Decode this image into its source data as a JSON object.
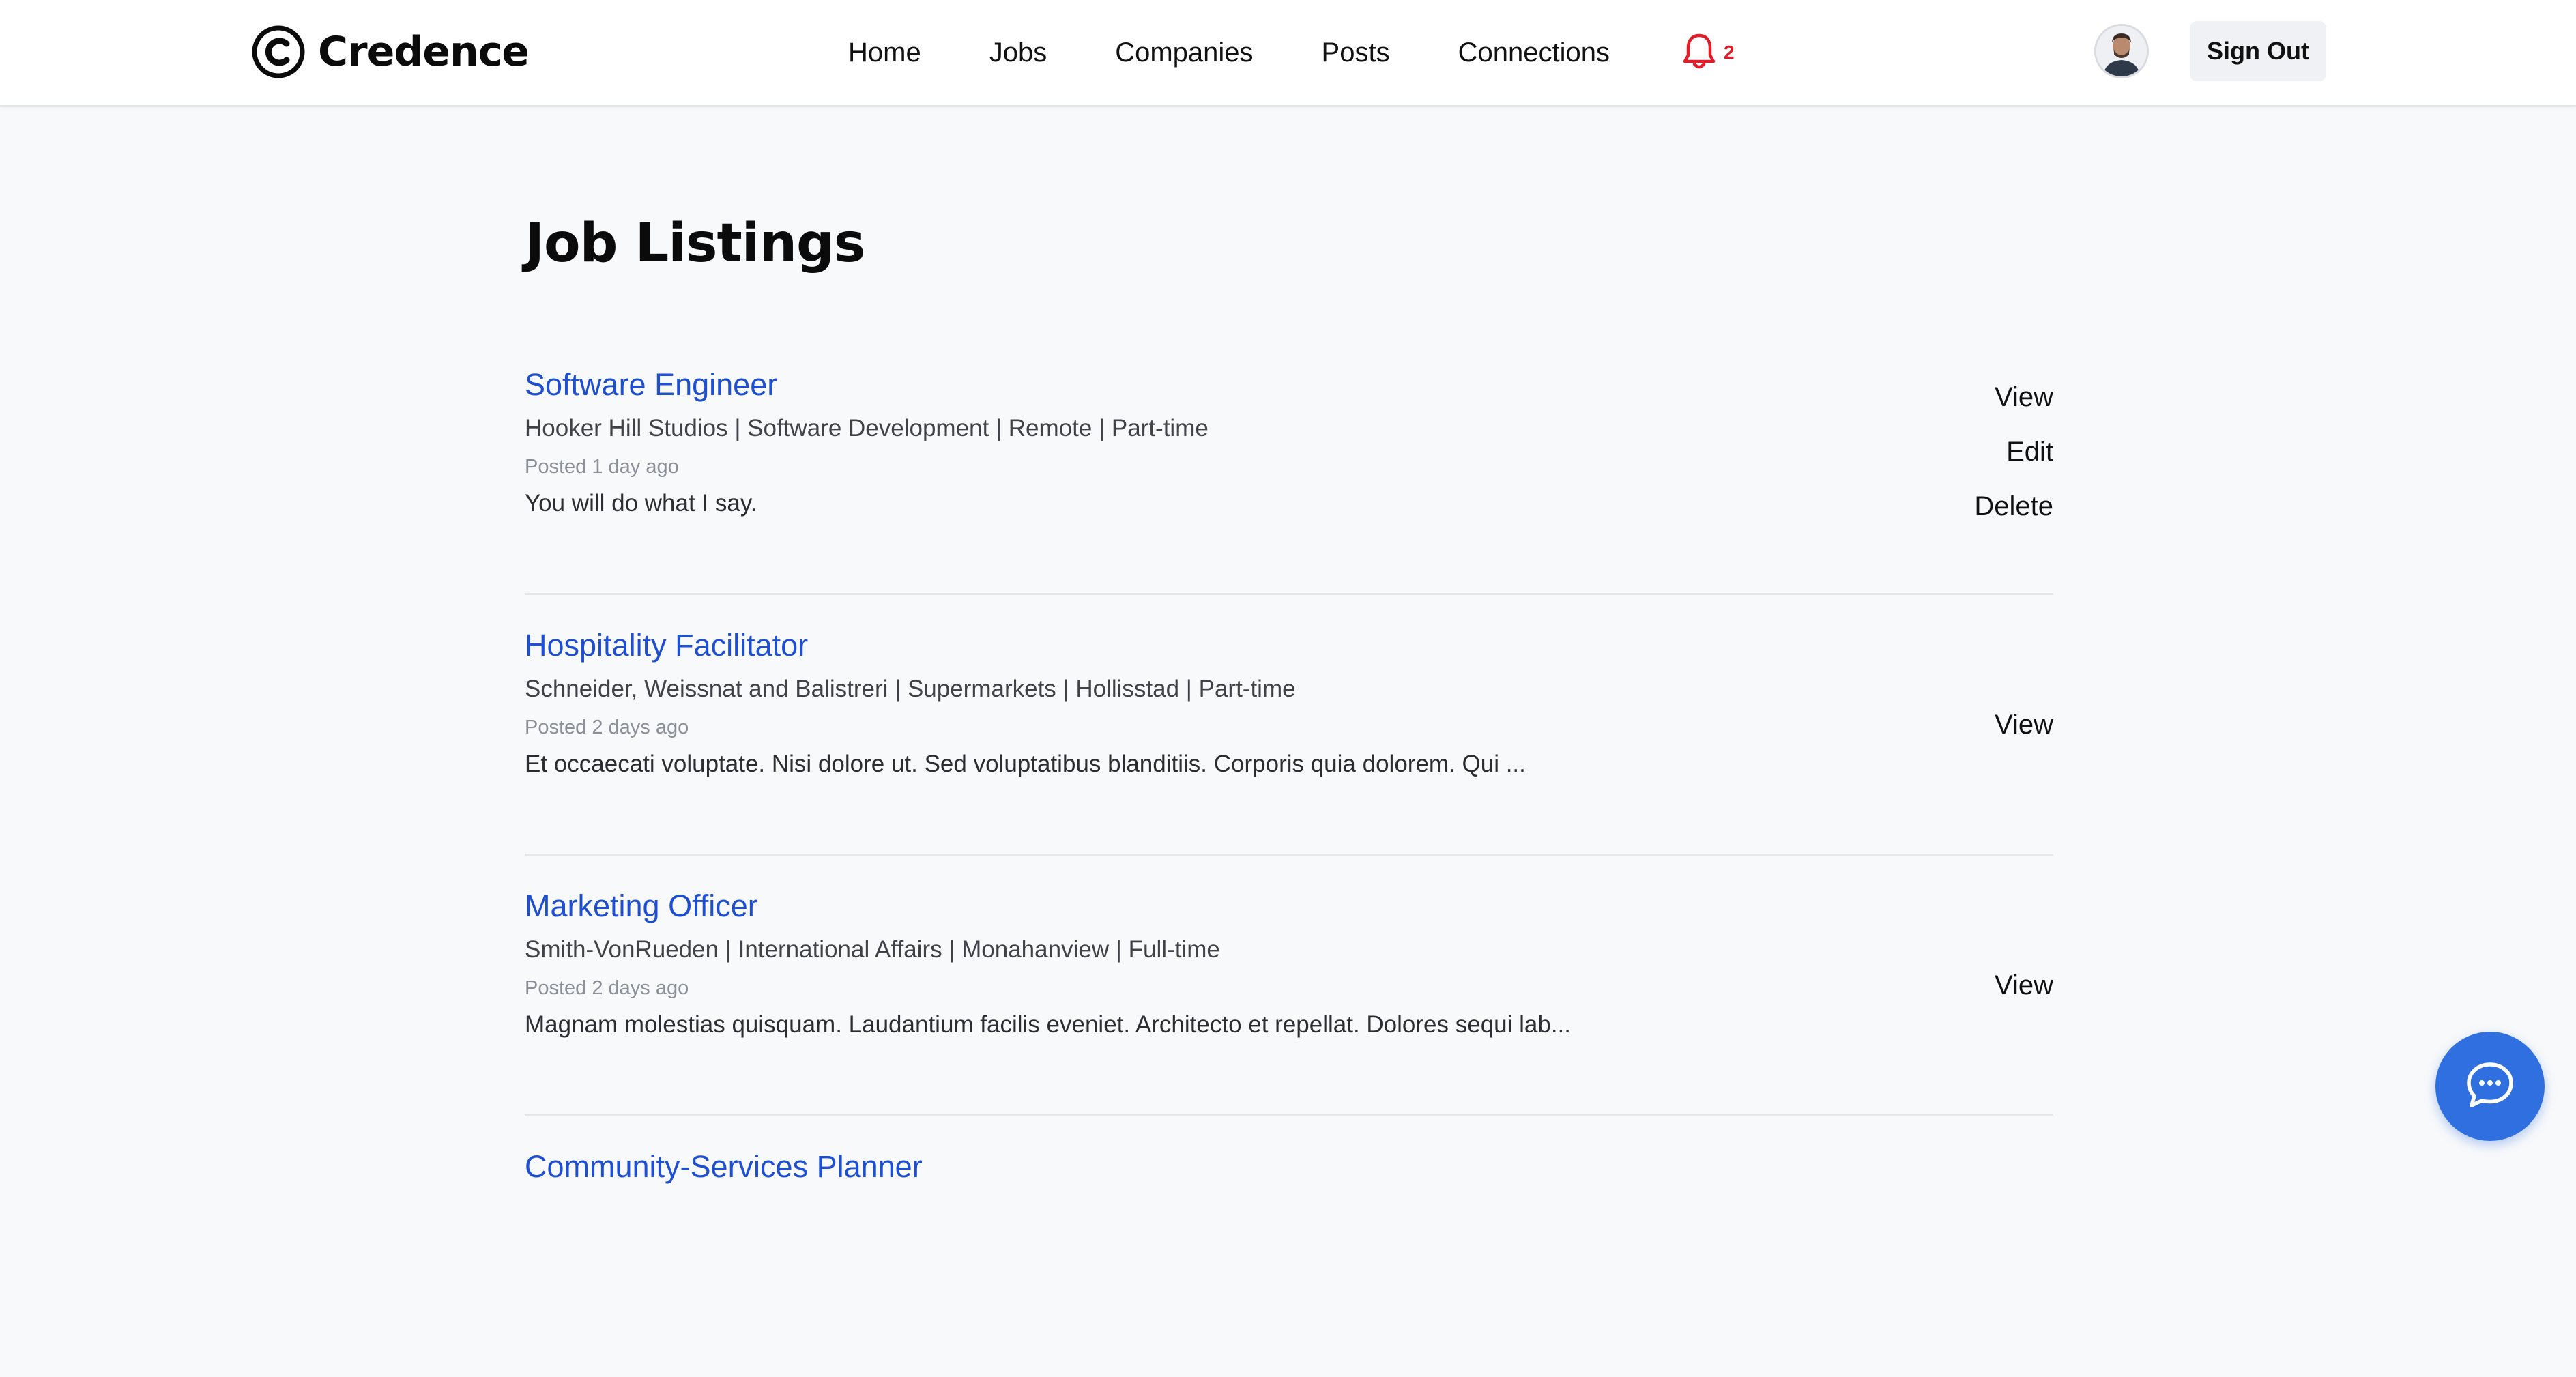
{
  "brand": {
    "name": "Credence",
    "logo_icon": "c-circle-logo-icon"
  },
  "nav": {
    "items": [
      {
        "label": "Home"
      },
      {
        "label": "Jobs"
      },
      {
        "label": "Companies"
      },
      {
        "label": "Posts"
      },
      {
        "label": "Connections"
      }
    ],
    "notifications": {
      "icon": "bell-icon",
      "count": "2",
      "color": "#e11d2a"
    }
  },
  "user": {
    "avatar_icon": "avatar",
    "sign_out_label": "Sign Out"
  },
  "page": {
    "title": "Job Listings"
  },
  "jobs": [
    {
      "title": "Software Engineer",
      "meta": "Hooker Hill Studios | Software Development | Remote | Part-time",
      "posted": "Posted 1 day ago",
      "description": "You will do what I say.",
      "actions": [
        "View",
        "Edit",
        "Delete"
      ]
    },
    {
      "title": "Hospitality Facilitator",
      "meta": "Schneider, Weissnat and Balistreri | Supermarkets | Hollisstad | Part-time",
      "posted": "Posted 2 days ago",
      "description": "Et occaecati voluptate. Nisi dolore ut. Sed voluptatibus blanditiis. Corporis quia dolorem. Qui ...",
      "actions": [
        "View"
      ]
    },
    {
      "title": "Marketing Officer",
      "meta": "Smith-VonRueden | International Affairs | Monahanview | Full-time",
      "posted": "Posted 2 days ago",
      "description": "Magnam molestias quisquam. Laudantium facilis eveniet. Architecto et repellat. Dolores sequi lab...",
      "actions": [
        "View"
      ]
    },
    {
      "title": "Community-Services Planner"
    }
  ],
  "chat": {
    "icon": "chat-bubble-icon",
    "color": "#2f6fe0"
  },
  "colors": {
    "link": "#1f4fd1",
    "background": "#f8f9fb"
  }
}
